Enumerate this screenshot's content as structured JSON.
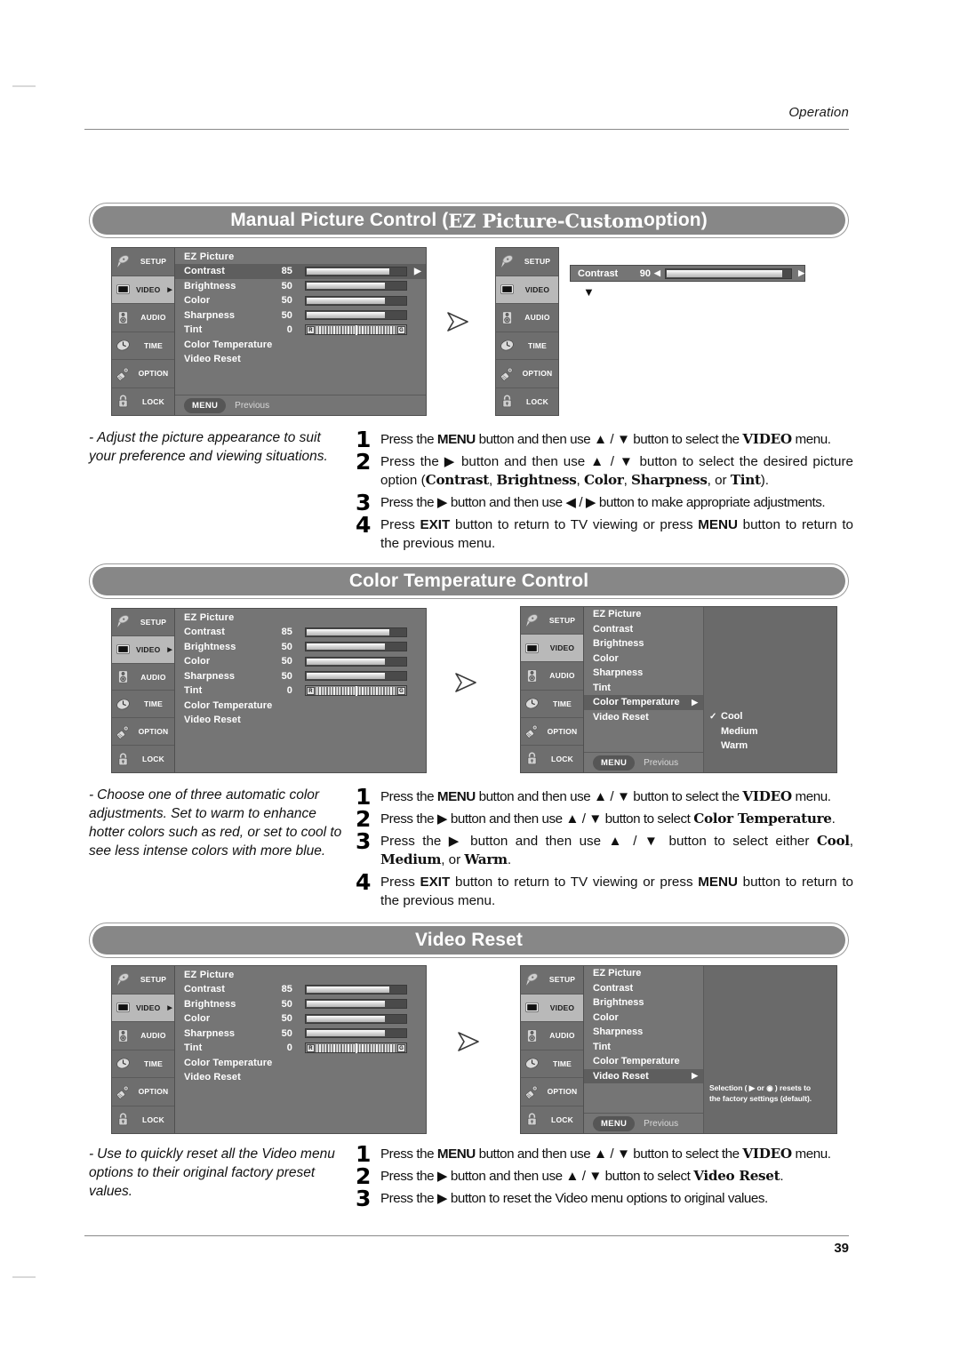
{
  "header": {
    "running_head": "Operation"
  },
  "footer": {
    "page_number": "39"
  },
  "sidebar_items": [
    {
      "label": "SETUP",
      "icon": "satellite-dish-icon"
    },
    {
      "label": "VIDEO",
      "icon": "tv-screen-icon"
    },
    {
      "label": "AUDIO",
      "icon": "speaker-icon"
    },
    {
      "label": "TIME",
      "icon": "clock-icon"
    },
    {
      "label": "OPTION",
      "icon": "remote-key-icon"
    },
    {
      "label": "LOCK",
      "icon": "padlock-icon"
    }
  ],
  "osd_common": {
    "title": "EZ Picture",
    "menu_button": "MENU",
    "previous_label": "Previous",
    "rows": [
      {
        "name": "Contrast",
        "value": "85",
        "bar": 82
      },
      {
        "name": "Brightness",
        "value": "50",
        "bar": 78
      },
      {
        "name": "Color",
        "value": "50",
        "bar": 78
      },
      {
        "name": "Sharpness",
        "value": "50",
        "bar": 78
      }
    ],
    "tint": {
      "name": "Tint",
      "value": "0",
      "left_cap": "R",
      "right_cap": "G"
    },
    "plain_rows": [
      "Color Temperature",
      "Video Reset"
    ]
  },
  "sections": [
    {
      "id": "manual-picture-control",
      "title_plain_1": "Manual Picture Control (",
      "title_ez": "EZ Picture-Custom",
      "title_plain_2": " option)",
      "description": "Adjust the picture appearance to suit your preference and viewing situations.",
      "right_osd": {
        "solo_name": "Contrast",
        "solo_value": "90",
        "solo_bar": 92,
        "left_arrow": "◀",
        "right_arrow": "▶"
      },
      "steps": [
        {
          "num": "1",
          "html": "Press the <b>MENU</b> button and then use ▲ / ▼ button to select the <span class=\"fat\">VIDEO</span> menu."
        },
        {
          "num": "2",
          "html": "Press the ▶ button and then use ▲ / ▼ button to select the desired picture option (<span class=\"fat\">Contrast</span>, <span class=\"fat\">Brightness</span>, <span class=\"fat\">Color</span>, <span class=\"fat\">Sharpness</span>, or <span class=\"fat\">Tint</span>)."
        },
        {
          "num": "3",
          "html": "Press the ▶ button and then use ◀ / ▶ button to make appropriate adjustments."
        },
        {
          "num": "4",
          "html": "Press <b>EXIT</b> button to return to TV viewing or press <b>MENU</b> button to return to the previous menu."
        }
      ]
    },
    {
      "id": "color-temperature-control",
      "title_plain_1": "Color Temperature Control",
      "title_ez": "",
      "title_plain_2": "",
      "description": "Choose one of three automatic color adjustments. Set to warm to enhance hotter colors such as red, or set to cool to see less intense colors with more blue.",
      "right_osd": {
        "list_rows": [
          "EZ Picture",
          "Contrast",
          "Brightness",
          "Color",
          "Sharpness",
          "Tint"
        ],
        "highlight_row": "Color Temperature",
        "highlight_caret": "▶",
        "after_row": "Video Reset",
        "options": [
          {
            "label": "Cool",
            "checked": true
          },
          {
            "label": "Medium",
            "checked": false
          },
          {
            "label": "Warm",
            "checked": false
          }
        ]
      },
      "steps": [
        {
          "num": "1",
          "html": "Press the <b>MENU</b> button and then use ▲ / ▼ button to select the <span class=\"fat\">VIDEO</span> menu."
        },
        {
          "num": "2",
          "html": "Press the ▶ button and then use ▲ / ▼ button to select <span class=\"fat\">Color Temperature</span>."
        },
        {
          "num": "3",
          "html": "Press the ▶ button and then use ▲ / ▼ button to select either <span class=\"fat\">Cool</span>, <span class=\"fat\">Medium</span>, or <span class=\"fat\">Warm</span>."
        },
        {
          "num": "4",
          "html": "Press <b>EXIT</b> button to return to TV viewing or press <b>MENU</b> button to return to the previous menu."
        }
      ]
    },
    {
      "id": "video-reset",
      "title_plain_1": "Video Reset",
      "title_ez": "",
      "title_plain_2": "",
      "description": "Use to quickly reset all the Video menu options to their original factory preset values.",
      "right_osd": {
        "list_rows": [
          "EZ Picture",
          "Contrast",
          "Brightness",
          "Color",
          "Sharpness",
          "Tint",
          "Color Temperature"
        ],
        "highlight_row": "Video Reset",
        "highlight_caret": "▶",
        "hint_line_1": "Selection ( ▶ or ◉ ) resets to",
        "hint_line_2": "the factory settings (default)."
      },
      "steps": [
        {
          "num": "1",
          "html": "Press the <b>MENU</b> button and then use ▲ / ▼ button to select the <span class=\"fat\">VIDEO</span> menu."
        },
        {
          "num": "2",
          "html": "Press the ▶ button and then use ▲ / ▼ button to select <span class=\"fat\">Video Reset</span>."
        },
        {
          "num": "3",
          "html": "Press the ▶ button to reset the Video menu options to original values."
        }
      ]
    }
  ]
}
